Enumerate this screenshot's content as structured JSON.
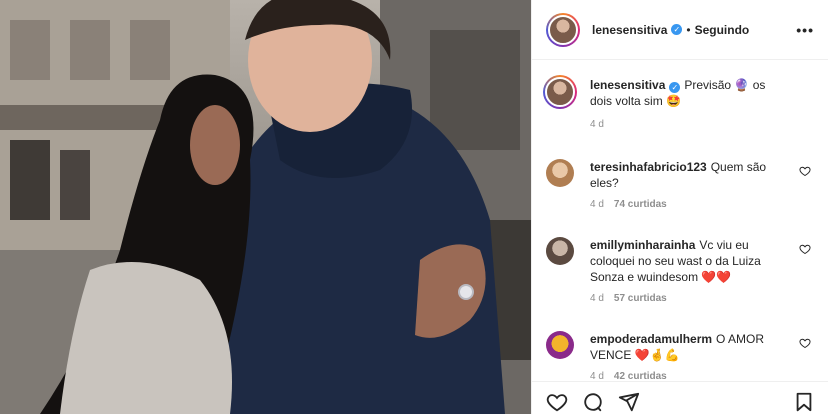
{
  "post": {
    "username": "lenesensitiva",
    "separator": "•",
    "follow_status": "Seguindo",
    "more_icon": "more-options-icon"
  },
  "caption": {
    "username": "lenesensitiva",
    "text_before": "Previsão",
    "emoji_ball": "🔮",
    "text_after": "os dois volta sim",
    "emoji_face": "🤩",
    "time": "4 d"
  },
  "comments": [
    {
      "username": "teresinhafabricio123",
      "text": "Quem são eles?",
      "time": "4 d",
      "likes": "74 curtidas"
    },
    {
      "username": "emillyminharainha",
      "text": "Vc viu eu coloquei no seu wast o da Luiza Sonza e wuindesom",
      "emoji": "❤️❤️",
      "time": "4 d",
      "likes": "57 curtidas"
    },
    {
      "username": "empoderadamulherm",
      "text": "O AMOR VENCE",
      "emoji": "❤️🤞💪",
      "time": "4 d",
      "likes": "42 curtidas"
    }
  ],
  "colors": {
    "verified": "#3897f0",
    "text": "#262626",
    "meta": "#8e8e8e",
    "heart_emoji": "#e0245e"
  }
}
